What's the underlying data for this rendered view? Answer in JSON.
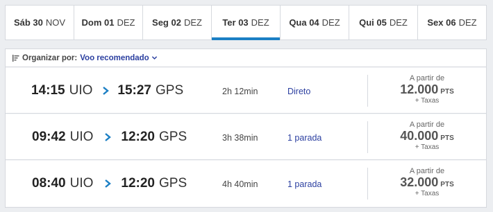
{
  "dates": [
    {
      "day": "Sáb 30",
      "month": "NOV",
      "selected": false
    },
    {
      "day": "Dom 01",
      "month": "DEZ",
      "selected": false
    },
    {
      "day": "Seg 02",
      "month": "DEZ",
      "selected": false
    },
    {
      "day": "Ter 03",
      "month": "DEZ",
      "selected": true
    },
    {
      "day": "Qua 04",
      "month": "DEZ",
      "selected": false
    },
    {
      "day": "Qui 05",
      "month": "DEZ",
      "selected": false
    },
    {
      "day": "Sex 06",
      "month": "DEZ",
      "selected": false
    }
  ],
  "sort": {
    "label": "Organizar por:",
    "value": "Voo recomendado"
  },
  "flights": [
    {
      "depart_time": "14:15",
      "depart_code": "UIO",
      "arrive_time": "15:27",
      "arrive_code": "GPS",
      "duration": "2h 12min",
      "stops": "Direto",
      "price_from": "A partir de",
      "price": "12.000",
      "price_unit": "PTS",
      "fees": "+ Taxas"
    },
    {
      "depart_time": "09:42",
      "depart_code": "UIO",
      "arrive_time": "12:20",
      "arrive_code": "GPS",
      "duration": "3h 38min",
      "stops": "1 parada",
      "price_from": "A partir de",
      "price": "40.000",
      "price_unit": "PTS",
      "fees": "+ Taxas"
    },
    {
      "depart_time": "08:40",
      "depart_code": "UIO",
      "arrive_time": "12:20",
      "arrive_code": "GPS",
      "duration": "4h 40min",
      "stops": "1 parada",
      "price_from": "A partir de",
      "price": "32.000",
      "price_unit": "PTS",
      "fees": "+ Taxas"
    }
  ],
  "colors": {
    "accent": "#1b7fc4",
    "link": "#2b3fa0",
    "background": "#eceef1"
  },
  "icons": {
    "sort": "sort-filter-icon",
    "dropdown": "chevron-down-icon",
    "arrow": "chevron-right-icon"
  }
}
